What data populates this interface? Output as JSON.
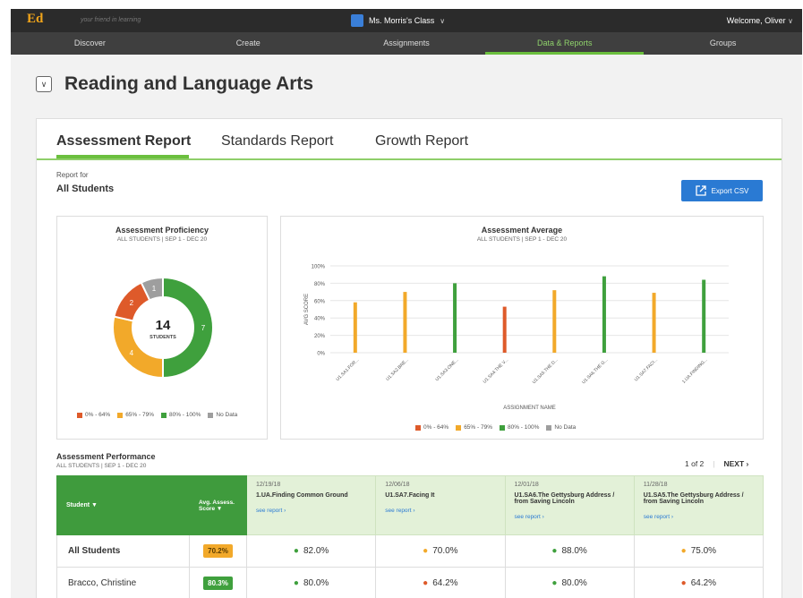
{
  "topbar": {
    "logo": "Ed",
    "tagline": "your friend in learning",
    "class_name": "Ms. Morris's Class",
    "welcome": "Welcome, Oliver"
  },
  "nav": [
    {
      "label": "Discover",
      "active": false
    },
    {
      "label": "Create",
      "active": false
    },
    {
      "label": "Assignments",
      "active": false
    },
    {
      "label": "Data & Reports",
      "active": true
    },
    {
      "label": "Groups",
      "active": false
    }
  ],
  "page_title": "Reading and Language Arts",
  "tabs": [
    {
      "label": "Assessment Report",
      "active": true
    },
    {
      "label": "Standards Report",
      "active": false
    },
    {
      "label": "Growth Report",
      "active": false
    }
  ],
  "report_for_label": "Report for",
  "report_for_value": "All Students",
  "export_label": "Export CSV",
  "colors": {
    "red": "#de5a2a",
    "orange": "#f2a92a",
    "green": "#3fa03d",
    "gray": "#9e9e9e",
    "blue": "#2a7ad3"
  },
  "proficiency": {
    "title": "Assessment Proficiency",
    "subtitle": "ALL STUDENTS | SEP 1 - DEC 20",
    "center_value": "14",
    "center_label": "STUDENTS",
    "legend": [
      "0% - 64%",
      "65% - 79%",
      "80% - 100%",
      "No Data"
    ]
  },
  "average": {
    "title": "Assessment Average",
    "subtitle": "ALL STUDENTS | SEP 1 - DEC 20",
    "legend": [
      "0% - 64%",
      "65% - 79%",
      "80% - 100%",
      "No Data"
    ]
  },
  "chart_data": [
    {
      "type": "pie",
      "title": "Assessment Proficiency",
      "categories": [
        "0% - 64%",
        "65% - 79%",
        "80% - 100%",
        "No Data"
      ],
      "values": [
        2,
        4,
        7,
        1
      ],
      "colors": [
        "#de5a2a",
        "#f2a92a",
        "#3fa03d",
        "#9e9e9e"
      ]
    },
    {
      "type": "bar",
      "title": "Assessment Average",
      "xlabel": "ASSIGNMENT NAME",
      "ylabel": "AVG SCORE",
      "ylim": [
        0,
        100
      ],
      "yticks": [
        "0%",
        "20%",
        "40%",
        "60%",
        "80%",
        "100%"
      ],
      "categories": [
        "U1.SA1.FOR...",
        "U1.SA2.BRE...",
        "U1.SA3.ONE...",
        "U1.SA4.THE V...",
        "U1.SA5.THE D...",
        "U1.SA6.THE G...",
        "U1.SA7.FACI...",
        "1.UA.FINDING..."
      ],
      "values": [
        58,
        70,
        80,
        53,
        72,
        88,
        69,
        84
      ],
      "bands": [
        "65% - 79%",
        "65% - 79%",
        "80% - 100%",
        "0% - 64%",
        "65% - 79%",
        "80% - 100%",
        "65% - 79%",
        "80% - 100%"
      ]
    }
  ],
  "performance": {
    "title": "Assessment Performance",
    "subtitle": "ALL STUDENTS | SEP 1 - DEC 20",
    "pager": "1 of 2",
    "next_label": "NEXT",
    "student_header": "Student",
    "score_header": "Avg. Assess. Score",
    "see_report": "see report",
    "assignments": [
      {
        "date": "12/19/18",
        "name": "1.UA.Finding Common Ground"
      },
      {
        "date": "12/06/18",
        "name": "U1.SA7.Facing It"
      },
      {
        "date": "12/01/18",
        "name": "U1.SA6.The Gettysburg Address / from Saving Lincoln"
      },
      {
        "date": "11/28/18",
        "name": "U1.SA5.The Gettysburg Address / from Saving Lincoln"
      }
    ],
    "rows": [
      {
        "name": "All Students",
        "avg": "70.2%",
        "avg_band": "orange",
        "scores": [
          [
            "82.0%",
            "green"
          ],
          [
            "70.0%",
            "orange"
          ],
          [
            "88.0%",
            "green"
          ],
          [
            "75.0%",
            "orange"
          ]
        ]
      },
      {
        "name": "Bracco, Christine",
        "avg": "80.3%",
        "avg_band": "green",
        "scores": [
          [
            "80.0%",
            "green"
          ],
          [
            "64.2%",
            "red"
          ],
          [
            "80.0%",
            "green"
          ],
          [
            "64.2%",
            "red"
          ]
        ]
      }
    ]
  }
}
